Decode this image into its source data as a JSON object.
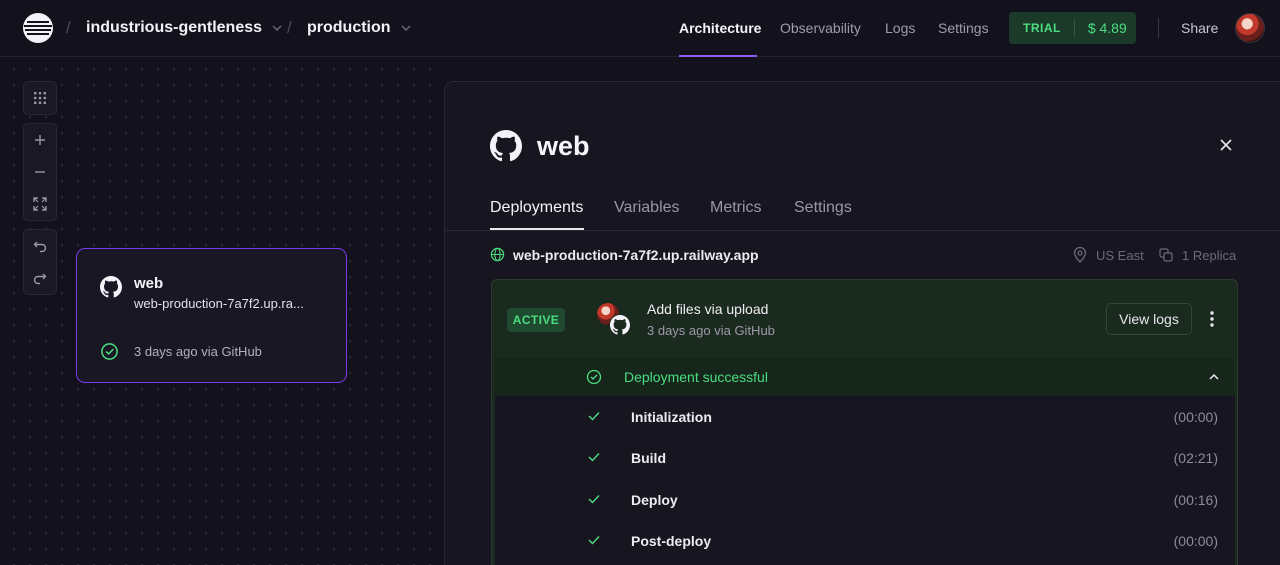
{
  "topnav": {
    "project_name": "industrious-gentleness",
    "environment": "production",
    "links": {
      "architecture": "Architecture",
      "observability": "Observability",
      "logs": "Logs",
      "settings": "Settings"
    },
    "active_link": "Architecture",
    "plan_label": "TRIAL",
    "credit": "$ 4.89",
    "share_label": "Share"
  },
  "canvas": {
    "tools": [
      "grid-icon",
      "plus-icon",
      "minus-icon",
      "fit-view-icon",
      "undo-icon",
      "redo-icon"
    ],
    "service_card": {
      "name": "web",
      "url": "web-production-7a7f2.up.ra...",
      "status": "3 days ago via GitHub"
    }
  },
  "panel": {
    "title": "web",
    "tabs": [
      "Deployments",
      "Variables",
      "Metrics",
      "Settings"
    ],
    "active_tab": "Deployments",
    "domain": "web-production-7a7f2.up.railway.app",
    "region": "US East",
    "replicas": "1 Replica",
    "deployment": {
      "status_badge": "ACTIVE",
      "commit_message": "Add files via upload",
      "commit_meta": "3 days ago via GitHub",
      "view_logs_label": "View logs",
      "result": "Deployment successful",
      "steps": [
        {
          "name": "Initialization",
          "duration": "(00:00)"
        },
        {
          "name": "Build",
          "duration": "(02:21)"
        },
        {
          "name": "Deploy",
          "duration": "(00:16)"
        },
        {
          "name": "Post-deploy",
          "duration": "(00:00)"
        }
      ]
    }
  },
  "colors": {
    "accent": "#8b5cf6",
    "success": "#4ade80",
    "background": "#13111c"
  }
}
